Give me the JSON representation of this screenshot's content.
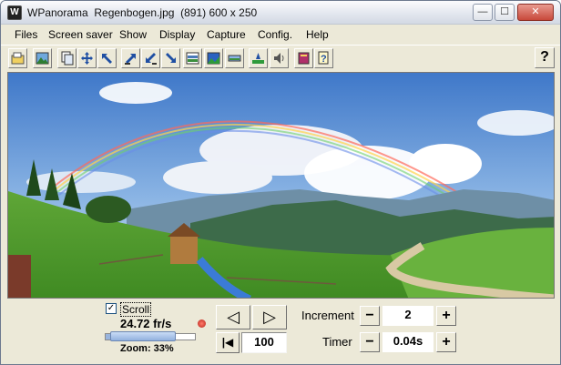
{
  "window": {
    "title": "WPanorama  Regenbogen.jpg  (891) 600 x 250",
    "app_icon": "panorama-app-icon",
    "minimize": "—",
    "maximize": "☐",
    "close": "✕"
  },
  "menu": [
    "Files",
    "Screen saver",
    "Show",
    "Display",
    "Capture",
    "Config.",
    "Help"
  ],
  "toolbar": {
    "buttons": [
      "open-icon",
      "image-icon",
      "copy-icon",
      "move-icon",
      "arrow-up-left-icon",
      "arrow-up-right-icon",
      "arrow-down-left-icon",
      "arrow-down-right-icon",
      "band-icon",
      "panorama-icon",
      "strip-icon",
      "horizon-icon",
      "speaker-icon",
      "book-icon",
      "help-page-icon"
    ],
    "help_label": "?"
  },
  "image": {
    "icon": "rainbow-landscape-image"
  },
  "scroll": {
    "label": "Scroll",
    "checked": "✓",
    "speed": "24.72 fr/s",
    "zoom_label": "Zoom: 33%",
    "zoom_level": 0.33
  },
  "navigation": {
    "prev_label": "◁",
    "next_label": "▷",
    "first_label": "|◀",
    "position": "100"
  },
  "increment": {
    "label": "Increment",
    "minus": "−",
    "value": "2",
    "plus": "+"
  },
  "timer": {
    "label": "Timer",
    "minus": "−",
    "value": "0.04s",
    "plus": "+"
  }
}
